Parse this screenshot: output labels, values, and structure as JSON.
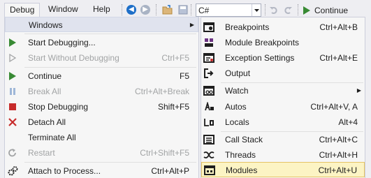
{
  "menubar": {
    "items": [
      {
        "label": "Debug"
      },
      {
        "label": "Window"
      },
      {
        "label": "Help"
      }
    ]
  },
  "toolbar": {
    "config_value": "C#",
    "continue_label": "Continue"
  },
  "debug_menu": {
    "items": [
      {
        "label": "Windows",
        "shortcut": "",
        "icon": "none",
        "submenu": true,
        "highlighted": true
      },
      {
        "label": "Start Debugging...",
        "shortcut": "",
        "icon": "green-play-icon"
      },
      {
        "label": "Start Without Debugging",
        "shortcut": "Ctrl+F5",
        "icon": "outline-play-icon",
        "disabled": true
      },
      {
        "label": "Continue",
        "shortcut": "F5",
        "icon": "green-play-icon"
      },
      {
        "label": "Break All",
        "shortcut": "Ctrl+Alt+Break",
        "icon": "pause-icon",
        "disabled": true
      },
      {
        "label": "Stop Debugging",
        "shortcut": "Shift+F5",
        "icon": "red-stop-icon"
      },
      {
        "label": "Detach All",
        "shortcut": "",
        "icon": "red-x-icon"
      },
      {
        "label": "Terminate All",
        "shortcut": "",
        "icon": "none"
      },
      {
        "label": "Restart",
        "shortcut": "Ctrl+Shift+F5",
        "icon": "restart-icon",
        "disabled": true
      },
      {
        "label": "Attach to Process...",
        "shortcut": "Ctrl+Alt+P",
        "icon": "gears-icon"
      }
    ]
  },
  "windows_menu": {
    "items": [
      {
        "label": "Breakpoints",
        "shortcut": "Ctrl+Alt+B",
        "icon": "breakpoints-icon"
      },
      {
        "label": "Module Breakpoints",
        "shortcut": "",
        "icon": "module-breakpoints-icon"
      },
      {
        "label": "Exception Settings",
        "shortcut": "Ctrl+Alt+E",
        "icon": "exception-settings-icon"
      },
      {
        "label": "Output",
        "shortcut": "",
        "icon": "output-icon"
      },
      {
        "label": "Watch",
        "shortcut": "",
        "icon": "watch-icon",
        "submenu": true
      },
      {
        "label": "Autos",
        "shortcut": "Ctrl+Alt+V, A",
        "icon": "autos-icon"
      },
      {
        "label": "Locals",
        "shortcut": "Alt+4",
        "icon": "locals-icon"
      },
      {
        "label": "Call Stack",
        "shortcut": "Ctrl+Alt+C",
        "icon": "call-stack-icon"
      },
      {
        "label": "Threads",
        "shortcut": "Ctrl+Alt+H",
        "icon": "threads-icon"
      },
      {
        "label": "Modules",
        "shortcut": "Ctrl+Alt+U",
        "icon": "modules-icon",
        "highlighted": true
      }
    ]
  },
  "colors": {
    "menu_background": "#f6f6f6",
    "menu_border": "#cccedb",
    "highlight_background": "#fcf4c4",
    "highlight_border": "#e5c365",
    "hover_background": "#e0e3ee",
    "disabled_text": "#a2a4a5",
    "play_green": "#388a34",
    "stop_red": "#c72b2b",
    "nav_blue": "#1e6fc8"
  }
}
